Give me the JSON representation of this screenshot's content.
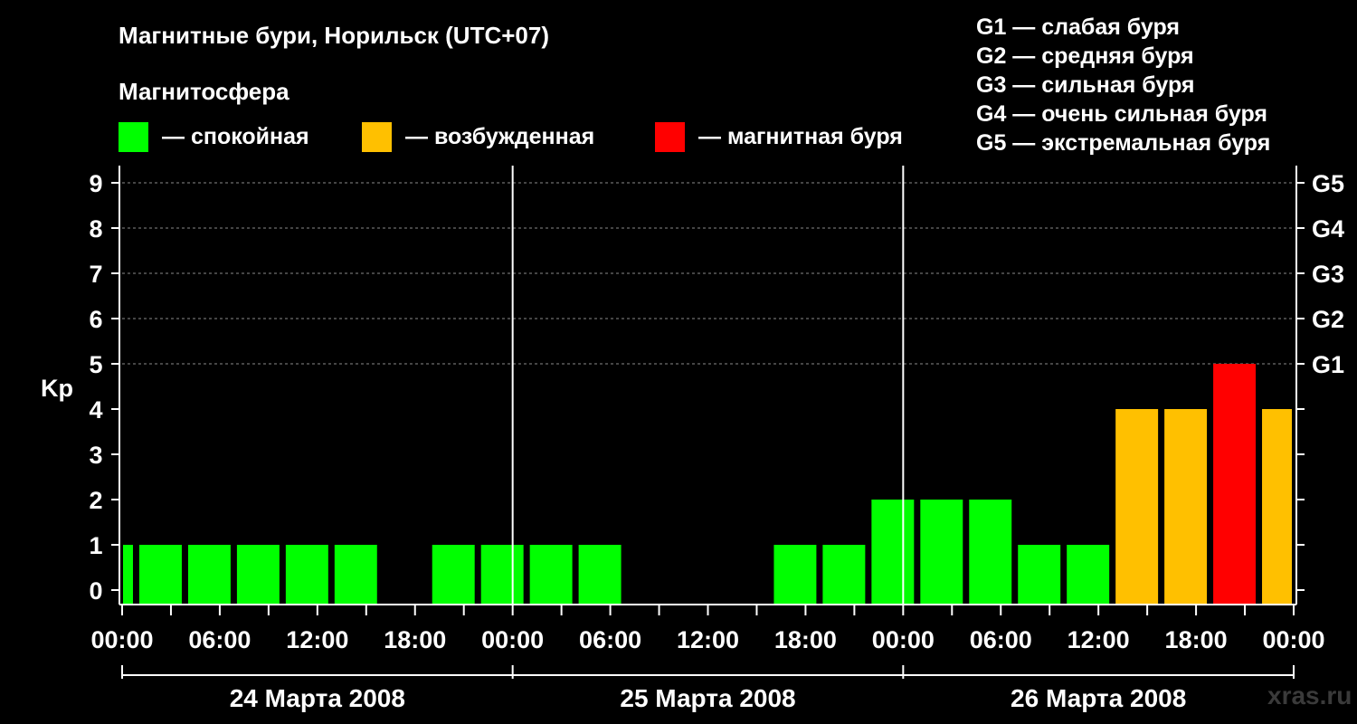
{
  "title": "Магнитные бури, Норильск (UTC+07)",
  "subtitle": "Магнитосфера",
  "legend": [
    {
      "label": "— спокойная",
      "color": "#00ff00"
    },
    {
      "label": "— возбужденная",
      "color": "#ffc000"
    },
    {
      "label": "— магнитная буря",
      "color": "#ff0000"
    }
  ],
  "g_legend": [
    "G1 — слабая буря",
    "G2 — средняя буря",
    "G3 — сильная буря",
    "G4 — очень сильная буря",
    "G5 — экстремальная буря"
  ],
  "watermark": "xras.ru",
  "chart_data": {
    "type": "bar",
    "title": "Магнитные бури, Норильск (UTC+07)",
    "ylabel": "Kp",
    "ylim": [
      0,
      9
    ],
    "yticks": [
      0,
      1,
      2,
      3,
      4,
      5,
      6,
      7,
      8,
      9
    ],
    "g_ticks": [
      {
        "value": 5,
        "label": "G1"
      },
      {
        "value": 6,
        "label": "G2"
      },
      {
        "value": 7,
        "label": "G3"
      },
      {
        "value": 8,
        "label": "G4"
      },
      {
        "value": 9,
        "label": "G5"
      }
    ],
    "xticks": [
      "00:00",
      "06:00",
      "12:00",
      "18:00",
      "00:00",
      "06:00",
      "12:00",
      "18:00",
      "00:00",
      "06:00",
      "12:00",
      "18:00",
      "00:00"
    ],
    "days": [
      "24 Марта 2008",
      "25 Марта 2008",
      "26 Марта 2008"
    ],
    "interval_hours": 3,
    "start_hour": -2,
    "values": [
      1,
      1,
      1,
      1,
      1,
      1,
      0,
      1,
      1,
      1,
      1,
      0,
      0,
      0,
      1,
      1,
      2,
      2,
      2,
      1,
      1,
      4,
      4,
      5,
      4
    ],
    "level_colors": {
      "quiet": "#00ff00",
      "active": "#ffc000",
      "storm": "#ff0000"
    },
    "grid": true
  }
}
